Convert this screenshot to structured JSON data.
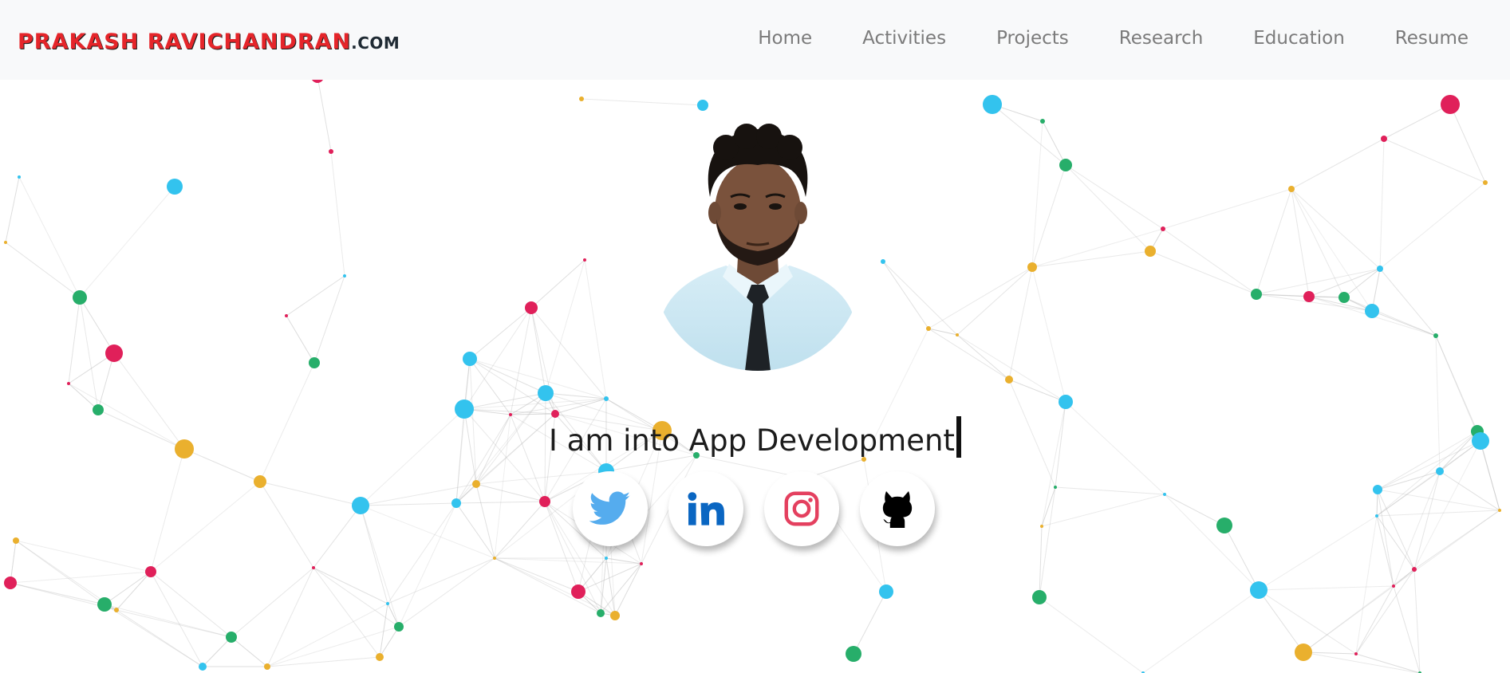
{
  "header": {
    "brand_name": "PRAKASH RAVICHANDRAN",
    "brand_tld": ".COM",
    "nav": [
      {
        "label": "Home"
      },
      {
        "label": "Activities"
      },
      {
        "label": "Projects"
      },
      {
        "label": "Research"
      },
      {
        "label": "Education"
      },
      {
        "label": "Resume"
      }
    ]
  },
  "hero": {
    "avatar_icon": "profile-photo",
    "headline": "I am into App Development",
    "socials": [
      {
        "icon": "twitter-icon",
        "color": "#55acee"
      },
      {
        "icon": "linkedin-icon",
        "color": "#0a66c2"
      },
      {
        "icon": "instagram-icon",
        "color": "#e4405f"
      },
      {
        "icon": "github-icon",
        "color": "#000000"
      }
    ]
  },
  "colors": {
    "brand_red": "#e5252a",
    "nav_text": "#7b7b7b",
    "navbar_bg": "#f8f9fa",
    "node_blue": "#33c3ee",
    "node_red": "#e0205a",
    "node_green": "#27ae6a",
    "node_yellow": "#eab02e"
  }
}
